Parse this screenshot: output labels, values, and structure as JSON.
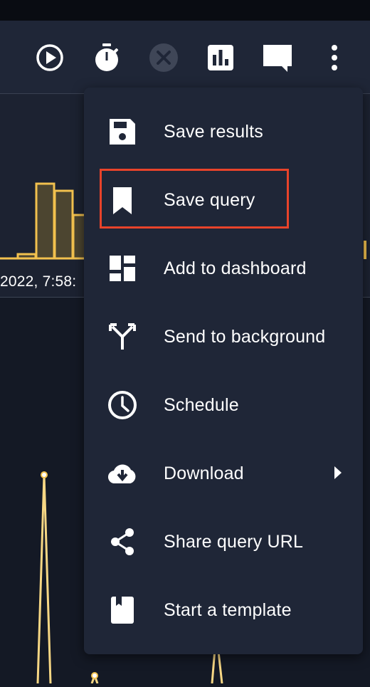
{
  "toolbar": {
    "buttons": [
      {
        "name": "run-icon",
        "enabled": true
      },
      {
        "name": "timer-icon",
        "enabled": true
      },
      {
        "name": "cancel-icon",
        "enabled": false
      },
      {
        "name": "chart-icon",
        "enabled": true
      },
      {
        "name": "comment-icon",
        "enabled": true
      },
      {
        "name": "more-vert-icon",
        "enabled": true
      }
    ]
  },
  "chart": {
    "time_label": "2022, 7:58:",
    "bar_color": "#f2c14e"
  },
  "menu": {
    "items": [
      {
        "label": "Save results",
        "icon": "save-icon"
      },
      {
        "label": "Save query",
        "icon": "bookmark-icon",
        "highlighted": true
      },
      {
        "label": "Add to dashboard",
        "icon": "dashboard-icon"
      },
      {
        "label": "Send to background",
        "icon": "call-split-icon"
      },
      {
        "label": "Schedule",
        "icon": "clock-icon"
      },
      {
        "label": "Download",
        "icon": "cloud-download-icon",
        "has_submenu": true
      },
      {
        "label": "Share query URL",
        "icon": "share-icon"
      },
      {
        "label": "Start a template",
        "icon": "template-icon"
      }
    ]
  },
  "colors": {
    "highlight": "#e8432a",
    "menu_bg": "#1f2637",
    "page_bg": "#141925"
  }
}
